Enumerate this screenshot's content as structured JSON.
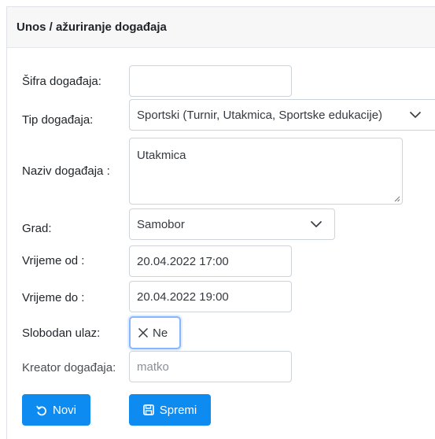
{
  "header": {
    "title": "Unos / ažuriranje događaja"
  },
  "form": {
    "sifra": {
      "label": "Šifra događaja:",
      "value": ""
    },
    "tip": {
      "label": "Tip događaja:",
      "value": "Sportski (Turnir, Utakmica, Sportske edukacije)"
    },
    "naziv": {
      "label": "Naziv događaja :",
      "value": "Utakmica"
    },
    "grad": {
      "label": "Grad:",
      "value": "Samobor"
    },
    "vrijeme_od": {
      "label": "Vrijeme od :",
      "value": "20.04.2022 17:00"
    },
    "vrijeme_do": {
      "label": "Vrijeme do :",
      "value": "20.04.2022 19:00"
    },
    "slobodan_ulaz": {
      "label": "Slobodan ulaz:",
      "value": "Ne"
    },
    "kreator": {
      "label": "Kreator događaja:",
      "value": "matko"
    }
  },
  "buttons": {
    "novi": "Novi",
    "spremi": "Spremi"
  },
  "icons": {
    "toggle": "x-icon",
    "novi": "undo-icon",
    "spremi": "save-icon",
    "select": "chevron-down-icon"
  },
  "colors": {
    "primary": "#0d8bf0",
    "focus_border": "#86b7fe"
  }
}
